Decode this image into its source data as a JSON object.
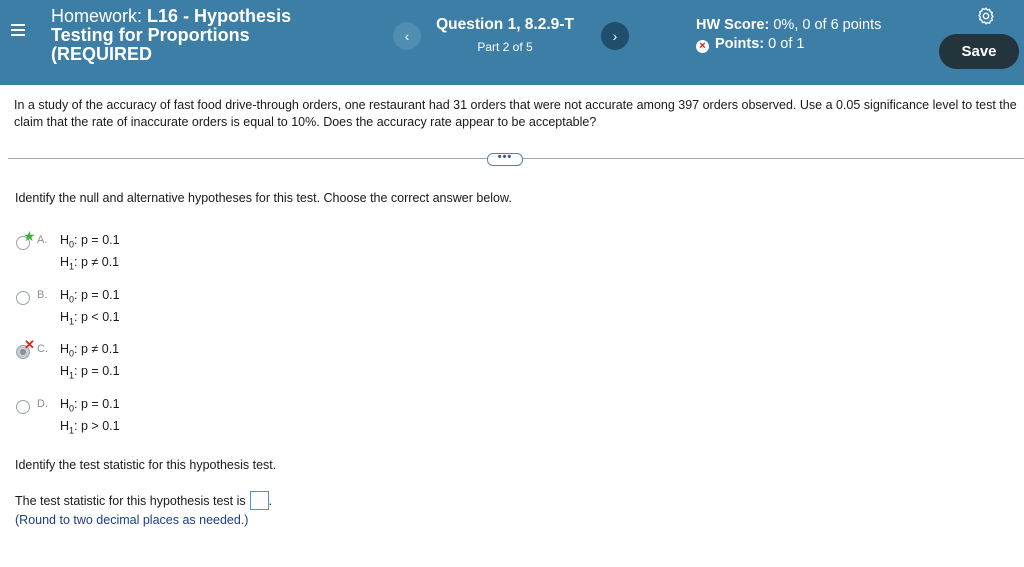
{
  "header": {
    "hw_prefix": "Homework:",
    "hw_code": "L16 - Hypothesis",
    "hw_line2": "Testing for Proportions",
    "hw_line3": "(REQUIRED",
    "question_title": "Question 1, 8.2.9-T",
    "question_part": "Part 2 of 5",
    "prev_symbol": "‹",
    "next_symbol": "›",
    "hw_score_label": "HW Score:",
    "hw_score_value": "0%, 0 of 6 points",
    "points_label": "Points:",
    "points_value": "0 of 1",
    "save_label": "Save"
  },
  "problem": {
    "text": "In a study of the accuracy of fast food drive-through orders, one restaurant had 31 orders that were not accurate among 397 orders observed. Use a 0.05 significance level to test the claim that the rate of inaccurate orders is equal to 10%. Does the accuracy rate appear to be acceptable?",
    "more_label": "•••"
  },
  "part1": {
    "instruction": "Identify the null and alternative hypotheses for this test. Choose the correct answer below.",
    "choices": [
      {
        "letter": "A.",
        "h0": "H",
        "h0_sub": "0",
        "h0_rest": ": p = 0.1",
        "h1": "H",
        "h1_sub": "1",
        "h1_rest": ": p ≠ 0.1",
        "mark": "★"
      },
      {
        "letter": "B.",
        "h0": "H",
        "h0_sub": "0",
        "h0_rest": ": p = 0.1",
        "h1": "H",
        "h1_sub": "1",
        "h1_rest": ": p < 0.1",
        "mark": ""
      },
      {
        "letter": "C.",
        "h0": "H",
        "h0_sub": "0",
        "h0_rest": ": p ≠ 0.1",
        "h1": "H",
        "h1_sub": "1",
        "h1_rest": ": p = 0.1",
        "mark": "✕"
      },
      {
        "letter": "D.",
        "h0": "H",
        "h0_sub": "0",
        "h0_rest": ": p = 0.1",
        "h1": "H",
        "h1_sub": "1",
        "h1_rest": ": p > 0.1",
        "mark": ""
      }
    ]
  },
  "part2": {
    "instruction": "Identify the test statistic for this hypothesis test.",
    "prompt": "The test statistic for this hypothesis test is",
    "trailing": ".",
    "hint": "(Round to two decimal places as needed.)"
  },
  "colors": {
    "header_bg": "#3c7ea6",
    "save_bg": "#24343d",
    "correct_star": "#3fae3a",
    "wrong_x": "#dd2222",
    "hint_text": "#1a3e8a"
  }
}
